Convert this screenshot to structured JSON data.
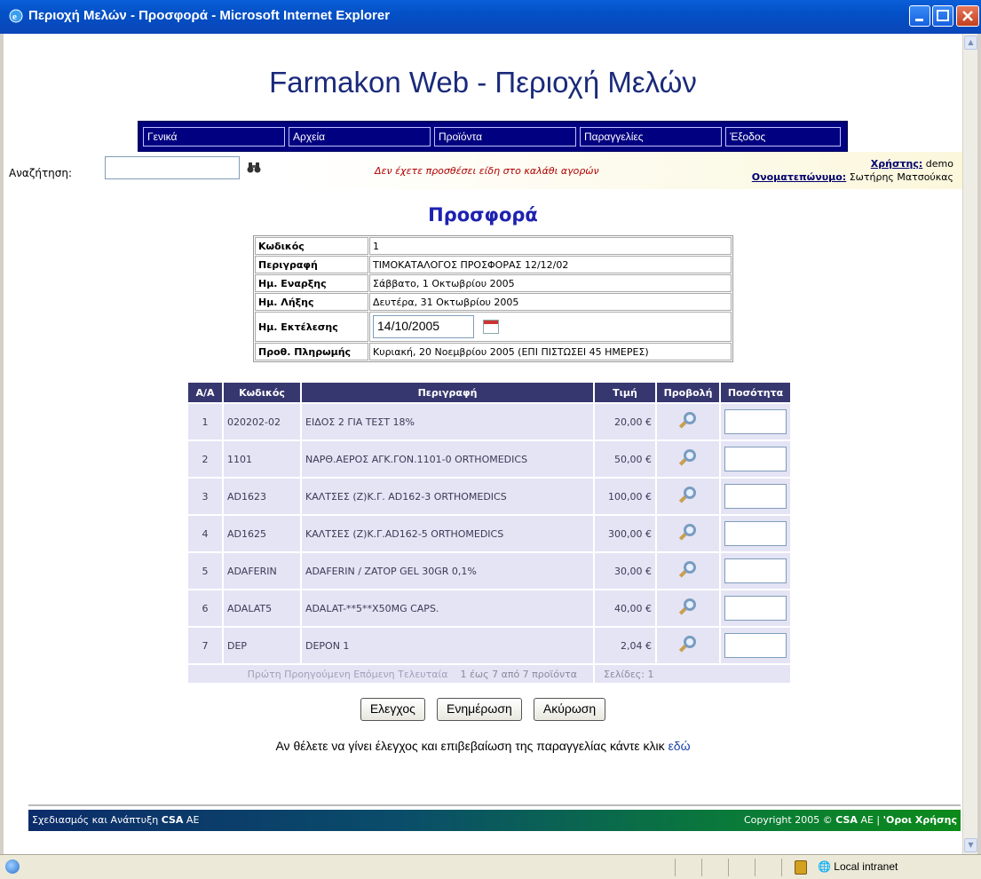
{
  "window": {
    "title": "Περιοχή Μελών - Προσφορά - Microsoft Internet Explorer"
  },
  "site": {
    "title": "Farmakon Web - Περιοχή Μελών"
  },
  "nav": {
    "items": [
      "Γενικά",
      "Αρχεία",
      "Προϊόντα",
      "Παραγγελίες",
      "Έξοδος"
    ]
  },
  "search": {
    "label": "Αναζήτηση:",
    "value": ""
  },
  "cart": {
    "message": "Δεν έχετε προσθέσει είδη στο καλάθι αγορών"
  },
  "user": {
    "user_label": "Χρήστης:",
    "user_value": "demo",
    "name_label": "Ονοματεπώνυμο:",
    "name_value": "Σωτήρης Ματσούκας"
  },
  "offer": {
    "heading": "Προσφορά",
    "fields": {
      "code_label": "Κωδικός",
      "code_value": "1",
      "desc_label": "Περιγραφή",
      "desc_value": "ΤΙΜΟΚΑΤΑΛΟΓΟΣ ΠΡΟΣΦΟΡΑΣ 12/12/02",
      "start_label": "Ημ. Εναρξης",
      "start_value": "Σάββατο, 1 Οκτωβρίου 2005",
      "end_label": "Ημ. Λήξης",
      "end_value": "Δευτέρα, 31 Οκτωβρίου 2005",
      "exec_label": "Ημ. Εκτέλεσης",
      "exec_value": "14/10/2005",
      "pay_label": "Προθ. Πληρωμής",
      "pay_value": "Κυριακή, 20 Νοεμβρίου 2005 (ΕΠΙ ΠΙΣΤΩΣΕΙ 45 ΗΜΕΡΕΣ)"
    }
  },
  "products": {
    "headers": [
      "Α/Α",
      "Κωδικός",
      "Περιγραφή",
      "Τιμή",
      "Προβολή",
      "Ποσότητα"
    ],
    "rows": [
      {
        "aa": "1",
        "code": "020202-02",
        "desc": "ΕΙΔΟΣ 2 ΓΙΑ ΤΕΣΤ 18%",
        "price": "20,00 €"
      },
      {
        "aa": "2",
        "code": "1101",
        "desc": "ΝΑΡΘ.ΑΕΡΟΣ ΑΓΚ.ΓΟΝ.1101-0 ORTHOMEDICS",
        "price": "50,00 €"
      },
      {
        "aa": "3",
        "code": "AD1623",
        "desc": "ΚΑΛΤΣΕΣ (Ζ)Κ.Γ. AD162-3 ORTHOMEDICS",
        "price": "100,00 €"
      },
      {
        "aa": "4",
        "code": "AD1625",
        "desc": "ΚΑΛΤΣΕΣ (Ζ)Κ.Γ.AD162-5 ORTHOMEDICS",
        "price": "300,00 €"
      },
      {
        "aa": "5",
        "code": "ADAFERIN",
        "desc": "ADAFERIN / ZATOP GEL 30GR 0,1%",
        "price": "30,00 €"
      },
      {
        "aa": "6",
        "code": "ADALAT5",
        "desc": "ADALAT-**5**X50MG CAPS.",
        "price": "40,00 €"
      },
      {
        "aa": "7",
        "code": "DEP",
        "desc": "DEPON 1",
        "price": "2,04 €"
      }
    ],
    "pager": {
      "links": "Πρώτη Προηγούμενη Επόμενη Τελευταία",
      "count": "1 έως 7 από 7 προϊόντα",
      "pages": "Σελίδες: 1"
    }
  },
  "actions": {
    "check": "Ελεγχος",
    "update": "Ενημέρωση",
    "cancel": "Ακύρωση"
  },
  "confirm": {
    "text": "Αν θέλετε να γίνει έλεγχος και επιβεβαίωση της παραγγελίας κάντε κλικ",
    "link": "εδώ"
  },
  "footer": {
    "left_text": "Σχεδιασμός και Ανάπτυξη",
    "left_brand": "CSA",
    "left_suffix": "ΑΕ",
    "right_text": "Copyright 2005 ©",
    "right_brand": "CSA",
    "right_suffix": "ΑΕ |",
    "terms": "'Οροι Χρήσης"
  },
  "status": {
    "zone": "Local intranet"
  }
}
